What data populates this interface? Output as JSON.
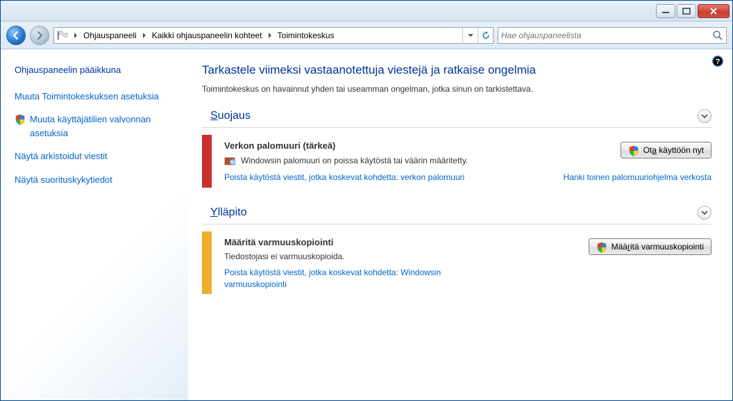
{
  "titlebar": {
    "min": "−",
    "max": "▢",
    "close": "×"
  },
  "breadcrumbs": [
    "",
    "Ohjauspaneeli",
    "Kaikki ohjauspaneelin kohteet",
    "Toimintokeskus"
  ],
  "search": {
    "placeholder": "Hae ohjauspaneelista"
  },
  "sidebar": {
    "title": "Ohjauspaneelin pääikkuna",
    "links": [
      "Muuta Toimintokeskuksen asetuksia",
      "Muuta käyttäjätilien valvonnan asetuksia",
      "Näytä arkistoidut viestit",
      "Näytä suorituskykytiedot"
    ]
  },
  "main": {
    "title": "Tarkastele viimeksi vastaanotettuja viestejä ja ratkaise ongelmia",
    "subtitle": "Toimintokeskus on havainnut yhden tai useamman ongelman, jotka sinun on tarkistettava.",
    "security_header_pre": "S",
    "security_header_post": "uojaus",
    "maint_header_pre": "Y",
    "maint_header_post": "lläpito",
    "sec_card": {
      "title": "Verkon palomuuri  (tärkeä)",
      "desc": "Windowsin palomuuri on poissa käytöstä tai väärin määritetty.",
      "link1": "Poista käytöstä viestit, jotka koskevat kohdetta: verkon palomuuri",
      "link2": "Hanki toinen palomuuriohjelma verkosta",
      "btn_pre": "Ot",
      "btn_ul": "a",
      "btn_post": " käyttöön nyt"
    },
    "maint_card": {
      "title": "Määritä varmuuskopiointi",
      "desc": "Tiedostojasi ei varmuuskopioida.",
      "link1": "Poista käytöstä viestit, jotka koskevat kohdetta: Windowsin varmuuskopiointi",
      "btn_pre": "Mää",
      "btn_ul": "r",
      "btn_post": "itä varmuuskopiointi"
    }
  }
}
